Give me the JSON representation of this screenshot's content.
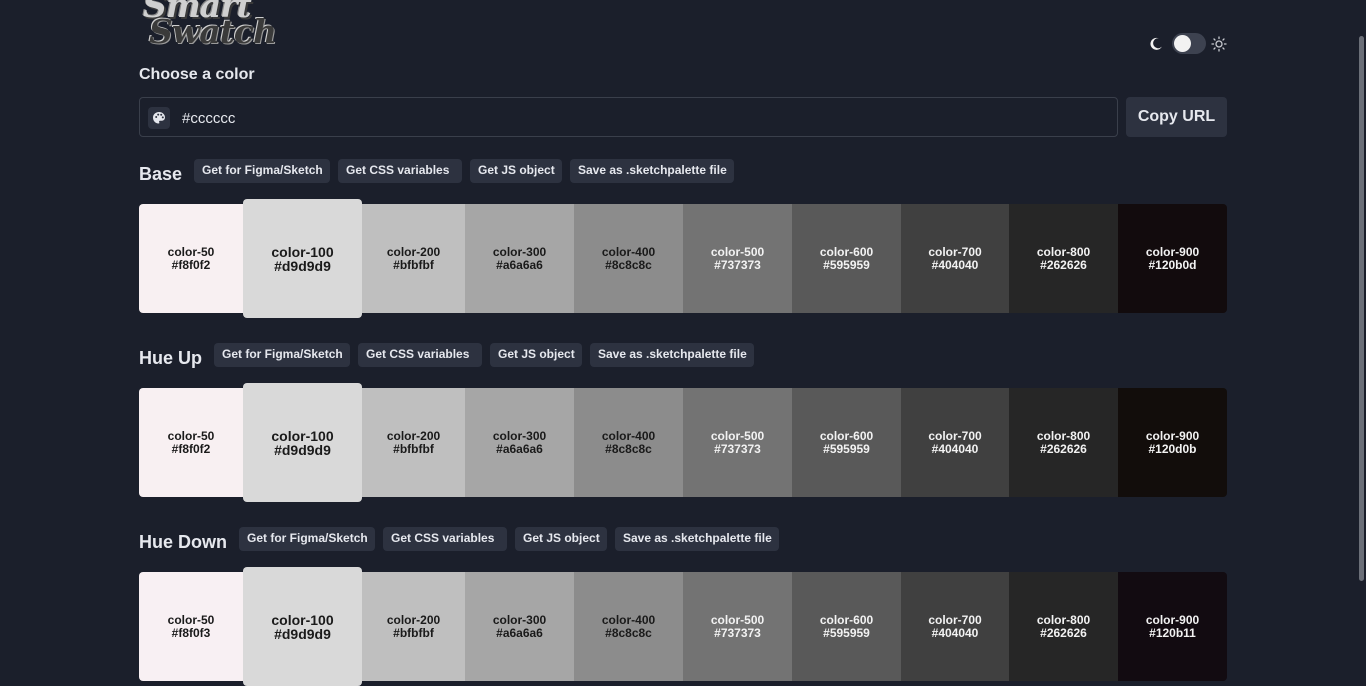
{
  "app": {
    "logo_line1": "Smart",
    "logo_line2": "Swatch"
  },
  "theme_toggle": {
    "dark_icon": "moon-icon",
    "light_icon": "sun-icon",
    "is_light": false
  },
  "picker": {
    "label": "Choose a color",
    "value": "#cccccc",
    "icon": "palette-icon",
    "copy_label": "Copy URL"
  },
  "actions": {
    "figma": "Get for Figma/Sketch",
    "css": "Get CSS variables",
    "js": "Get JS object",
    "sketch": "Save as .sketchpalette file"
  },
  "palettes": [
    {
      "title": "Base",
      "swatches": [
        {
          "name": "color-50",
          "hex": "#f8f0f2"
        },
        {
          "name": "color-100",
          "hex": "#d9d9d9"
        },
        {
          "name": "color-200",
          "hex": "#bfbfbf"
        },
        {
          "name": "color-300",
          "hex": "#a6a6a6"
        },
        {
          "name": "color-400",
          "hex": "#8c8c8c"
        },
        {
          "name": "color-500",
          "hex": "#737373"
        },
        {
          "name": "color-600",
          "hex": "#595959"
        },
        {
          "name": "color-700",
          "hex": "#404040"
        },
        {
          "name": "color-800",
          "hex": "#262626"
        },
        {
          "name": "color-900",
          "hex": "#120b0d"
        }
      ]
    },
    {
      "title": "Hue Up",
      "swatches": [
        {
          "name": "color-50",
          "hex": "#f8f0f2"
        },
        {
          "name": "color-100",
          "hex": "#d9d9d9"
        },
        {
          "name": "color-200",
          "hex": "#bfbfbf"
        },
        {
          "name": "color-300",
          "hex": "#a6a6a6"
        },
        {
          "name": "color-400",
          "hex": "#8c8c8c"
        },
        {
          "name": "color-500",
          "hex": "#737373"
        },
        {
          "name": "color-600",
          "hex": "#595959"
        },
        {
          "name": "color-700",
          "hex": "#404040"
        },
        {
          "name": "color-800",
          "hex": "#262626"
        },
        {
          "name": "color-900",
          "hex": "#120d0b"
        }
      ]
    },
    {
      "title": "Hue Down",
      "swatches": [
        {
          "name": "color-50",
          "hex": "#f8f0f3"
        },
        {
          "name": "color-100",
          "hex": "#d9d9d9"
        },
        {
          "name": "color-200",
          "hex": "#bfbfbf"
        },
        {
          "name": "color-300",
          "hex": "#a6a6a6"
        },
        {
          "name": "color-400",
          "hex": "#8c8c8c"
        },
        {
          "name": "color-500",
          "hex": "#737373"
        },
        {
          "name": "color-600",
          "hex": "#595959"
        },
        {
          "name": "color-700",
          "hex": "#404040"
        },
        {
          "name": "color-800",
          "hex": "#262626"
        },
        {
          "name": "color-900",
          "hex": "#120b11"
        }
      ]
    }
  ]
}
